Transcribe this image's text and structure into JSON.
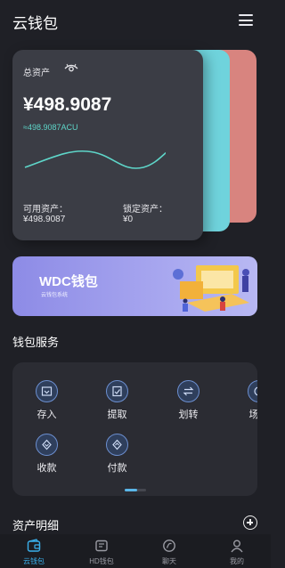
{
  "header": {
    "title": "云钱包"
  },
  "asset_card": {
    "label": "总资产",
    "total": "¥498.9087",
    "total_acu": "≈498.9087ACU",
    "available_label": "可用资产：",
    "available_value": "¥498.9087",
    "locked_label": "锁定资产：",
    "locked_value": "¥0",
    "colors": {
      "card": "#3b3d45",
      "back_teal": "#6fd3dc",
      "back_red": "#d8847f",
      "accent": "#5ed6c9"
    }
  },
  "banner": {
    "title": "WDC钱包",
    "subtitle": "云钱包系统"
  },
  "services": {
    "title": "钱包服务",
    "items": [
      {
        "label": "存入",
        "icon": "deposit-icon"
      },
      {
        "label": "提取",
        "icon": "withdraw-icon"
      },
      {
        "label": "划转",
        "icon": "transfer-icon"
      },
      {
        "label": "场外",
        "icon": "otc-icon"
      },
      {
        "label": "收款",
        "icon": "receive-icon"
      },
      {
        "label": "付款",
        "icon": "pay-icon"
      }
    ],
    "page": {
      "current": 1,
      "total": 2
    }
  },
  "details": {
    "title": "资产明细"
  },
  "tabbar": {
    "items": [
      {
        "label": "云钱包",
        "icon": "wallet-icon",
        "active": true
      },
      {
        "label": "HD钱包",
        "icon": "hd-wallet-icon",
        "active": false
      },
      {
        "label": "聊天",
        "icon": "chat-icon",
        "active": false
      },
      {
        "label": "我的",
        "icon": "profile-icon",
        "active": false
      }
    ],
    "colors": {
      "active": "#3ab0ec",
      "inactive": "#9a9ba3"
    }
  }
}
